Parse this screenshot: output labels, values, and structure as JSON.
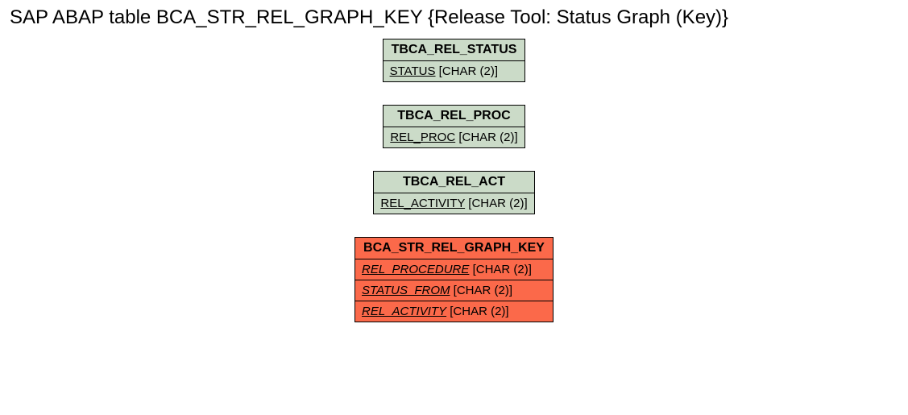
{
  "title": "SAP ABAP table BCA_STR_REL_GRAPH_KEY {Release Tool: Status Graph (Key)}",
  "tables": [
    {
      "name": "TBCA_REL_STATUS",
      "fields": [
        {
          "field": "STATUS",
          "type": " [CHAR (2)]",
          "italic": false
        }
      ],
      "highlight": false
    },
    {
      "name": "TBCA_REL_PROC",
      "fields": [
        {
          "field": "REL_PROC",
          "type": " [CHAR (2)]",
          "italic": false
        }
      ],
      "highlight": false
    },
    {
      "name": "TBCA_REL_ACT",
      "fields": [
        {
          "field": "REL_ACTIVITY",
          "type": " [CHAR (2)]",
          "italic": false
        }
      ],
      "highlight": false
    },
    {
      "name": "BCA_STR_REL_GRAPH_KEY",
      "fields": [
        {
          "field": "REL_PROCEDURE",
          "type": " [CHAR (2)]",
          "italic": true
        },
        {
          "field": "STATUS_FROM",
          "type": " [CHAR (2)]",
          "italic": true
        },
        {
          "field": "REL_ACTIVITY",
          "type": " [CHAR (2)]",
          "italic": true
        }
      ],
      "highlight": true
    }
  ]
}
